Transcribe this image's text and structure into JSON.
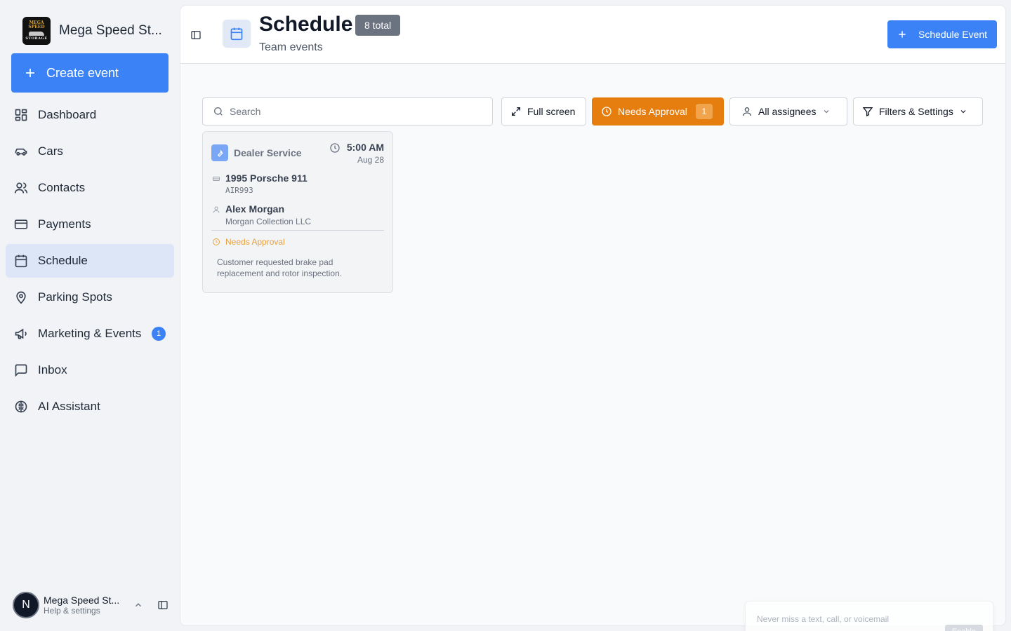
{
  "brand": {
    "name": "Mega Speed St...",
    "logo_top": "MEGA SPEED",
    "logo_bottom": "STORAGE"
  },
  "sidebar": {
    "create_label": "Create event",
    "items": [
      {
        "label": "Dashboard",
        "icon": "dashboard-icon"
      },
      {
        "label": "Cars",
        "icon": "car-icon"
      },
      {
        "label": "Contacts",
        "icon": "users-icon"
      },
      {
        "label": "Payments",
        "icon": "credit-card-icon"
      },
      {
        "label": "Schedule",
        "icon": "calendar-icon",
        "active": true
      },
      {
        "label": "Parking Spots",
        "icon": "map-pin-icon"
      },
      {
        "label": "Marketing & Events",
        "icon": "megaphone-icon",
        "badge": "1"
      },
      {
        "label": "Inbox",
        "icon": "message-square-icon"
      },
      {
        "label": "AI Assistant",
        "icon": "brain-icon"
      }
    ],
    "user": {
      "initial": "N",
      "name": "Mega Speed St...",
      "sub": "Help & settings"
    }
  },
  "header": {
    "title": "Schedule",
    "total_badge": "8 total",
    "subtitle": "Team events",
    "schedule_button": "Schedule Event"
  },
  "toolbar": {
    "search_placeholder": "Search",
    "fullscreen": "Full screen",
    "approval_label": "Needs Approval",
    "approval_count": "1",
    "assignees": "All assignees",
    "filters": "Filters & Settings"
  },
  "event": {
    "type": "Dealer Service",
    "time": "5:00 AM",
    "date": "Aug 28",
    "car": "1995 Porsche 911",
    "plate": "AIR993",
    "person": "Alex Morgan",
    "company": "Morgan Collection LLC",
    "status": "Needs Approval",
    "note": "Customer requested brake pad replacement and rotor inspection."
  },
  "toast": {
    "text": "Never miss a text, call, or voicemail",
    "button": "Enable"
  },
  "colors": {
    "accent": "#3b82f6",
    "approval": "#e67e0f",
    "active_nav": "#dde6f6",
    "status_warning": "#e8a03c"
  }
}
